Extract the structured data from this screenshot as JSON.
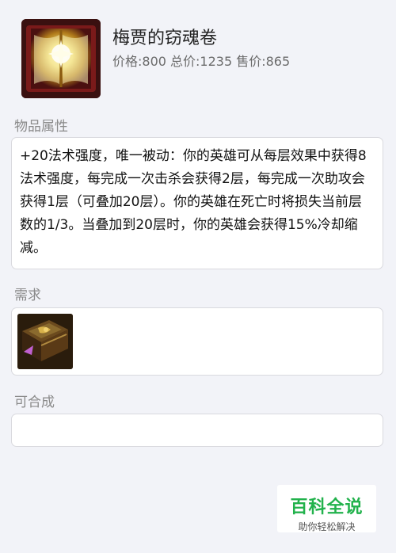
{
  "item": {
    "name": "梅贾的窃魂卷",
    "prices": "价格:800 总价:1235 售价:865",
    "icon": "glowing-spellbook-icon"
  },
  "sections": {
    "attributes_label": "物品属性",
    "attributes_text": "+20法术强度，唯一被动：你的英雄可从每层效果中获得8法术强度，每完成一次击杀会获得2层，每完成一次助攻会获得1层（可叠加20层）。你的英雄在死亡时将损失当前层数的1/3。当叠加到20层时，你的英雄会获得15%冷却缩减。",
    "requirements_label": "需求",
    "requirement_icon": "dark-tome-icon",
    "combines_label": "可合成"
  },
  "watermark": {
    "title": "百科全说",
    "subtitle": "助你轻松解决"
  },
  "colors": {
    "background": "#f2f3f8",
    "card": "#ffffff",
    "label": "#8a8a8a",
    "brand_green": "#22b24c"
  }
}
